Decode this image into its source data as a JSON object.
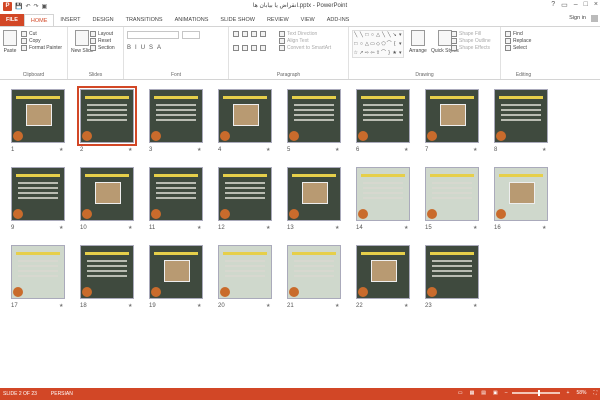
{
  "window": {
    "title": "انقراض یا بیابان ها.pptx - PowerPoint",
    "controls": [
      "?",
      "▭",
      "–",
      "□",
      "×"
    ]
  },
  "app_icon": "P",
  "tabs": [
    "FILE",
    "HOME",
    "INSERT",
    "DESIGN",
    "TRANSITIONS",
    "ANIMATIONS",
    "SLIDE SHOW",
    "REVIEW",
    "VIEW",
    "ADD-INS"
  ],
  "active_tab": "HOME",
  "signin": "Sign in",
  "ribbon": {
    "clipboard": {
      "label": "Clipboard",
      "paste": "Paste",
      "cut": "Cut",
      "copy": "Copy",
      "format_painter": "Format Painter"
    },
    "slides": {
      "label": "Slides",
      "new_slide": "New Slide",
      "layout": "Layout",
      "reset": "Reset",
      "section": "Section"
    },
    "font": {
      "label": "Font"
    },
    "paragraph": {
      "label": "Paragraph",
      "text_direction": "Text Direction",
      "align_text": "Align Text",
      "convert_smartart": "Convert to SmartArt"
    },
    "drawing": {
      "label": "Drawing",
      "arrange": "Arrange",
      "quick_styles": "Quick Styles",
      "shape_fill": "Shape Fill",
      "shape_outline": "Shape Outline",
      "shape_effects": "Shape Effects"
    },
    "editing": {
      "label": "Editing",
      "find": "Find",
      "replace": "Replace",
      "select": "Select"
    }
  },
  "slides": [
    {
      "n": "1"
    },
    {
      "n": "2"
    },
    {
      "n": "3"
    },
    {
      "n": "4"
    },
    {
      "n": "5"
    },
    {
      "n": "6"
    },
    {
      "n": "7"
    },
    {
      "n": "8"
    },
    {
      "n": "9"
    },
    {
      "n": "10"
    },
    {
      "n": "11"
    },
    {
      "n": "12"
    },
    {
      "n": "13"
    },
    {
      "n": "14"
    },
    {
      "n": "15"
    },
    {
      "n": "16"
    },
    {
      "n": "17"
    },
    {
      "n": "18"
    },
    {
      "n": "19"
    },
    {
      "n": "20"
    },
    {
      "n": "21"
    },
    {
      "n": "22"
    },
    {
      "n": "23"
    }
  ],
  "selected_slide": 2,
  "star": "★",
  "status": {
    "slide": "SLIDE 2 OF 23",
    "language": "PERSIAN",
    "zoom": "58%",
    "zoom_level": 0.58
  },
  "colors": {
    "accent": "#d24726",
    "slide_bg": "#3f4a3e"
  }
}
